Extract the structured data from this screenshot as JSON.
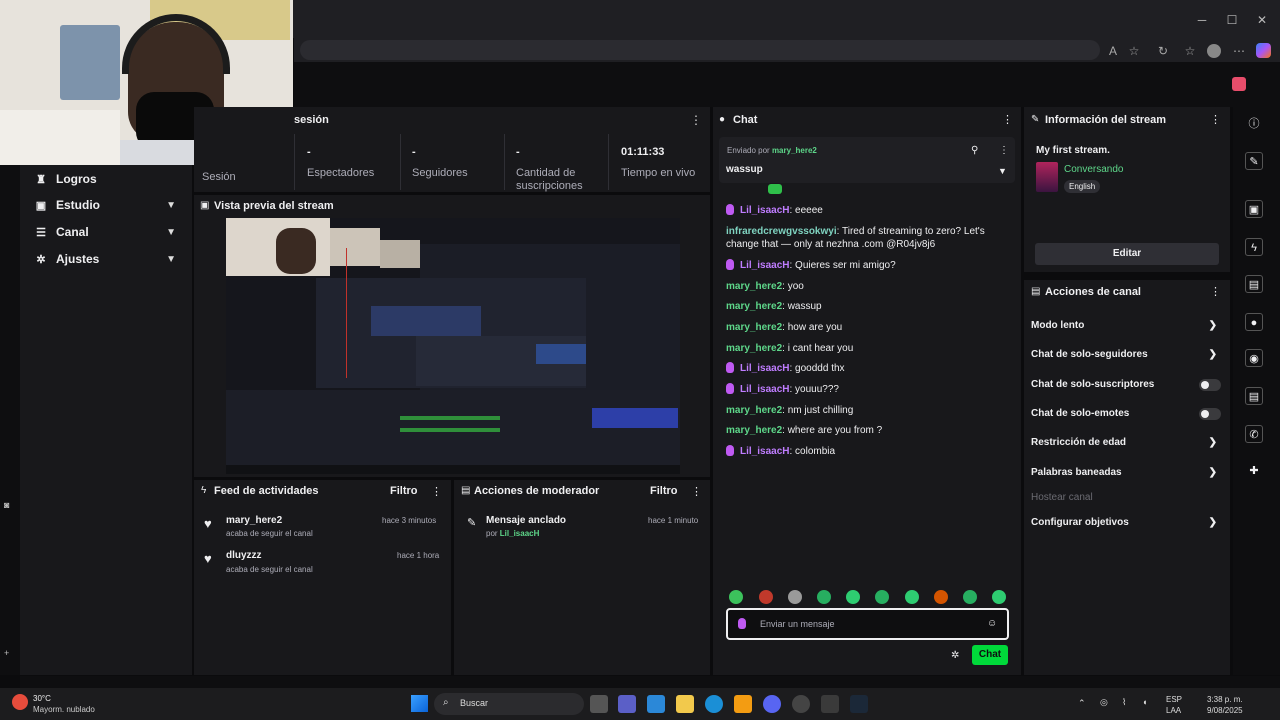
{
  "session": {
    "header": "sesión",
    "stats": [
      {
        "value": "",
        "label": "Sesión"
      },
      {
        "value": "-",
        "label": "Espectadores"
      },
      {
        "value": "-",
        "label": "Seguidores"
      },
      {
        "value": "-",
        "label": "Cantidad de suscripciones"
      },
      {
        "value": "01:11:33",
        "label": "Tiempo en vivo"
      }
    ]
  },
  "sidebar": {
    "items": [
      {
        "label": "Logros",
        "icon": "trophy-icon"
      },
      {
        "label": "Estudio",
        "icon": "studio-icon"
      },
      {
        "label": "Canal",
        "icon": "channel-icon"
      },
      {
        "label": "Ajustes",
        "icon": "gear-icon"
      }
    ]
  },
  "preview": {
    "title": "Vista previa del stream"
  },
  "feed": {
    "title": "Feed de actividades",
    "filter": "Filtro",
    "items": [
      {
        "user": "mary_here2",
        "action": "acaba de seguir el canal",
        "time": "hace 3 minutos"
      },
      {
        "user": "dluyzzz",
        "action": "acaba de seguir el canal",
        "time": "hace 1 hora"
      }
    ]
  },
  "mod": {
    "title": "Acciones de moderador",
    "filter": "Filtro",
    "items": [
      {
        "title": "Mensaje anclado",
        "by": "por",
        "user": "Lil_isaacH",
        "time": "hace 1 minuto"
      }
    ]
  },
  "chat": {
    "title": "Chat",
    "pinned": {
      "sent_by": "Enviado por",
      "user": "mary_here2",
      "text": "wassup"
    },
    "messages": [
      {
        "user": "Lil_isaacH",
        "text": ": eeeee",
        "color": "purple",
        "badge": true
      },
      {
        "user": "infraredcrewgvssokwyi",
        "text": ": Tired of streaming to zero? Let's change that — only at nezhna .com @R04jv8j6",
        "color": "teal",
        "badge": false
      },
      {
        "user": "Lil_isaacH",
        "text": ": Quieres ser mi amigo?",
        "color": "purple",
        "badge": true
      },
      {
        "user": "mary_here2",
        "text": ": yoo",
        "color": "green",
        "badge": false
      },
      {
        "user": "mary_here2",
        "text": ": wassup",
        "color": "green",
        "badge": false
      },
      {
        "user": "mary_here2",
        "text": ": how are you",
        "color": "green",
        "badge": false
      },
      {
        "user": "mary_here2",
        "text": ": i cant hear you",
        "color": "green",
        "badge": false
      },
      {
        "user": "Lil_isaacH",
        "text": ": gooddd thx",
        "color": "purple",
        "badge": true
      },
      {
        "user": "Lil_isaacH",
        "text": ": youuu???",
        "color": "purple",
        "badge": true
      },
      {
        "user": "mary_here2",
        "text": ": nm just chilling",
        "color": "green",
        "badge": false
      },
      {
        "user": "mary_here2",
        "text": ": where are you from ?",
        "color": "green",
        "badge": false
      },
      {
        "user": "Lil_isaacH",
        "text": ": colombia",
        "color": "purple",
        "badge": true
      }
    ],
    "input_placeholder": "Enviar un mensaje",
    "send_label": "Chat"
  },
  "info": {
    "title": "Información del stream",
    "stream_title": "My first stream.",
    "category": "Conversando",
    "language": "English",
    "edit": "Editar"
  },
  "actions": {
    "title": "Acciones de canal",
    "items": [
      {
        "label": "Modo lento",
        "type": "chevron"
      },
      {
        "label": "Chat de solo-seguidores",
        "type": "chevron"
      },
      {
        "label": "Chat de solo-suscriptores",
        "type": "toggle"
      },
      {
        "label": "Chat de solo-emotes",
        "type": "toggle"
      },
      {
        "label": "Restricción de edad",
        "type": "chevron"
      },
      {
        "label": "Palabras baneadas",
        "type": "chevron"
      },
      {
        "label": "Hostear canal",
        "type": "disabled"
      },
      {
        "label": "Configurar objetivos",
        "type": "chevron"
      }
    ]
  },
  "taskbar": {
    "temp": "30°C",
    "weather": "Mayorm. nublado",
    "search": "Buscar",
    "lang1": "ESP",
    "lang2": "LAA",
    "time": "3:38 p. m.",
    "date": "9/08/2025"
  },
  "colors": {
    "accent_green": "#00d93a",
    "purple": "#bf7dff",
    "panel": "#18181b"
  }
}
